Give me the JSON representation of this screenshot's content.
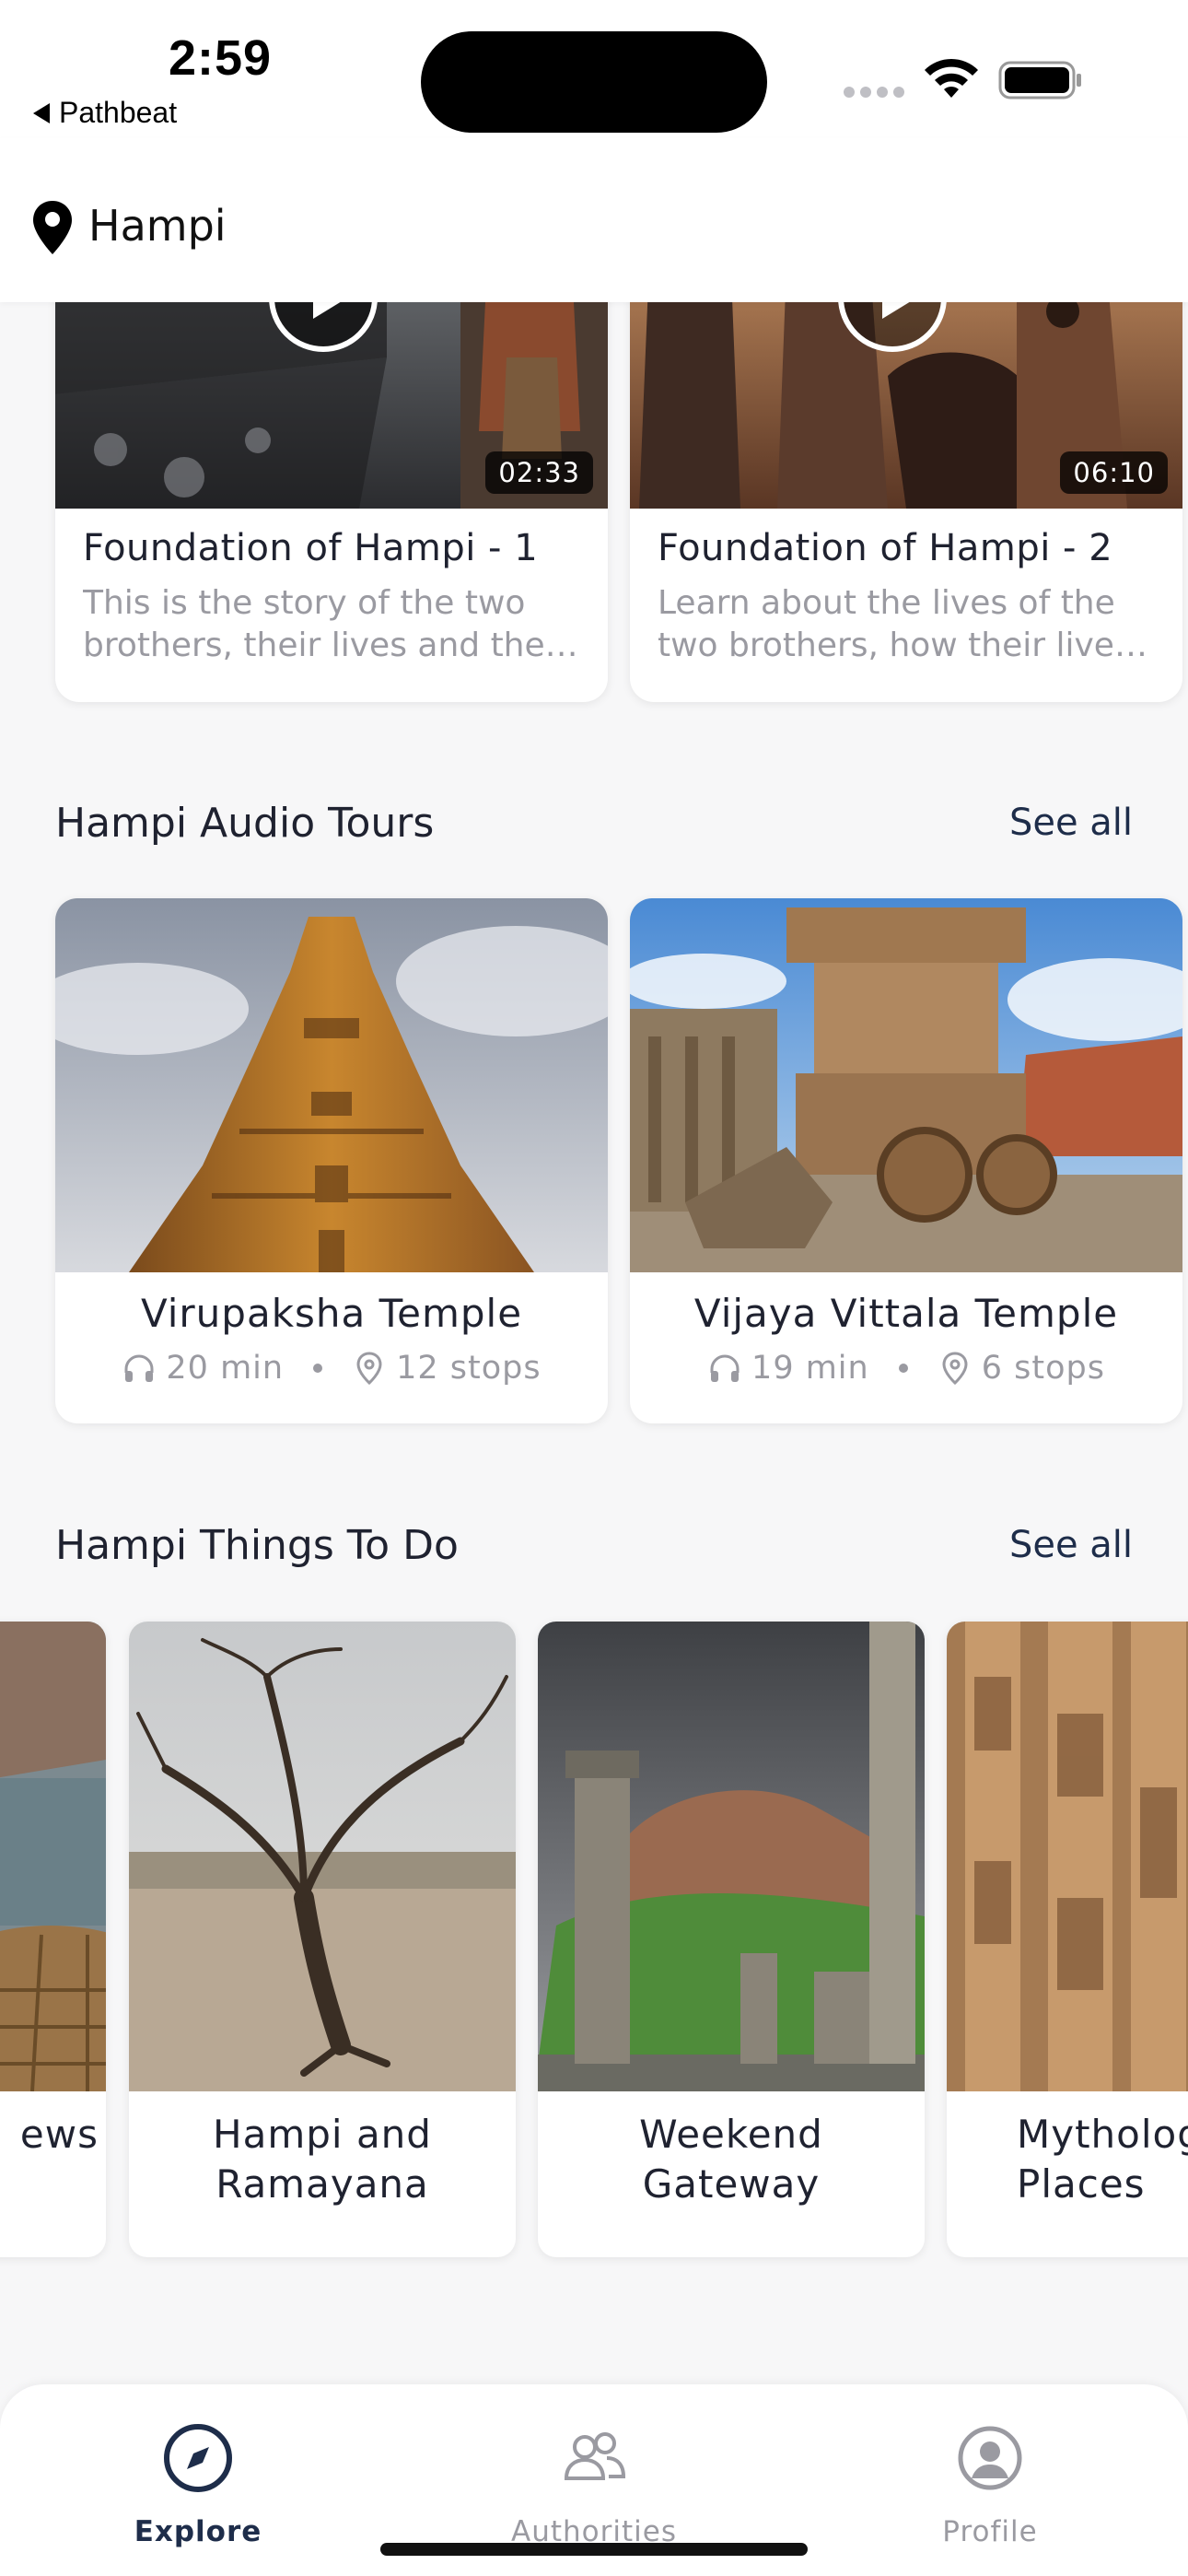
{
  "status_bar": {
    "time": "2:59",
    "back_app_label": "Pathbeat"
  },
  "location": {
    "name": "Hampi",
    "icon": "location-pin-icon"
  },
  "videos": [
    {
      "title": "Foundation of Hampi - 1",
      "description": "This is the story of the two brothers, their lives and the…",
      "duration": "02:33"
    },
    {
      "title": "Foundation of Hampi - 2",
      "description": "Learn about the lives of the two brothers, how their live…",
      "duration": "06:10"
    }
  ],
  "audio_tours": {
    "title": "Hampi Audio Tours",
    "see_all": "See all",
    "items": [
      {
        "title": "Virupaksha Temple",
        "duration": "20 min",
        "stops": "12 stops"
      },
      {
        "title": "Vijaya Vittala Temple",
        "duration": "19 min",
        "stops": "6 stops"
      }
    ]
  },
  "things_to_do": {
    "title": "Hampi Things To Do",
    "see_all": "See all",
    "items": [
      {
        "title": "ews"
      },
      {
        "title": "Hampi and\nRamayana"
      },
      {
        "title": "Weekend\nGateway"
      },
      {
        "title": "Mytholog\nPlaces"
      }
    ]
  },
  "tab_bar": {
    "tabs": [
      {
        "label": "Explore",
        "icon": "compass-icon",
        "active": true
      },
      {
        "label": "Authorities",
        "icon": "users-icon",
        "active": false
      },
      {
        "label": "Profile",
        "icon": "user-circle-icon",
        "active": false
      }
    ]
  },
  "colors": {
    "accent": "#1e2d4a",
    "muted_text": "#9a9aa1",
    "background": "#f7f7f8"
  }
}
